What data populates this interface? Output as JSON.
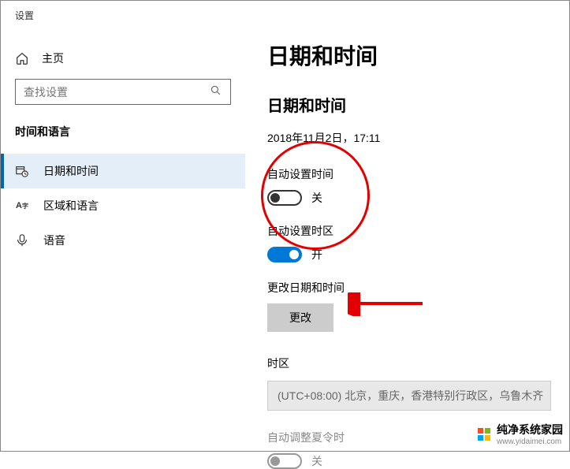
{
  "header": {
    "title": "设置"
  },
  "sidebar": {
    "home_label": "主页",
    "search_placeholder": "查找设置",
    "section_label": "时间和语言",
    "items": [
      {
        "label": "日期和时间"
      },
      {
        "label": "区域和语言"
      },
      {
        "label": "语音"
      }
    ]
  },
  "main": {
    "page_title": "日期和时间",
    "sub_title": "日期和时间",
    "datetime_value": "2018年11月2日，17:11",
    "auto_time_label": "自动设置时间",
    "auto_time_state": "关",
    "auto_tz_label": "自动设置时区",
    "auto_tz_state": "开",
    "change_section_label": "更改日期和时间",
    "change_button": "更改",
    "tz_label": "时区",
    "tz_value": "(UTC+08:00) 北京，重庆，香港特别行政区，乌鲁木齐",
    "dst_label": "自动调整夏令时",
    "dst_state": "关"
  },
  "watermark": {
    "title": "纯净系统家园",
    "url": "www.yidaimei.com"
  }
}
